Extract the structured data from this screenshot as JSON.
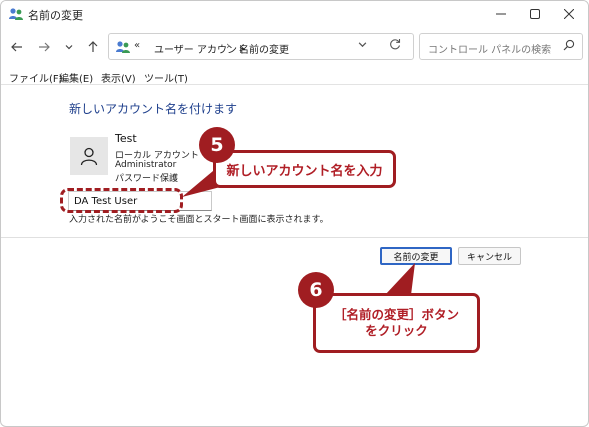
{
  "window": {
    "title": "名前の変更"
  },
  "nav": {
    "breadcrumb_overflow": "«",
    "breadcrumb": [
      "ユーザー アカウント",
      "名前の変更"
    ],
    "breadcrumb_separator": "›",
    "search_placeholder": "コントロール パネルの検索"
  },
  "menubar": {
    "items": [
      "ファイル(F)",
      "編集(E)",
      "表示(V)",
      "ツール(T)"
    ]
  },
  "content": {
    "heading": "新しいアカウント名を付けます",
    "account": {
      "name": "Test",
      "type": "ローカル アカウント",
      "role": "Administrator",
      "password": "パスワード保護"
    },
    "name_input_value": "DA Test User",
    "info_text": "入力された名前がようこそ画面とスタート画面に表示されます。",
    "buttons": {
      "change": "名前の変更",
      "cancel": "キャンセル"
    }
  },
  "callouts": {
    "step5": {
      "number": "5",
      "text": "新しいアカウント名を入力"
    },
    "step6": {
      "number": "6",
      "line1": "［名前の変更］ボタン",
      "line2": "をクリック"
    }
  },
  "colors": {
    "callout_accent": "#a01d21",
    "heading_blue": "#1e3f8c",
    "default_button_border": "#2f66c4"
  },
  "icons": [
    "users-icon",
    "minimize-icon",
    "maximize-icon",
    "close-icon",
    "back-arrow-icon",
    "forward-arrow-icon",
    "chevron-down-icon",
    "up-arrow-icon",
    "refresh-icon",
    "search-icon",
    "user-avatar-icon"
  ]
}
